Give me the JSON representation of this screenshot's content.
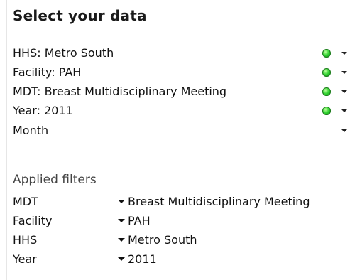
{
  "panel": {
    "title": "Select your data",
    "selectors": [
      {
        "label": "HHS:  Metro South",
        "status": "green"
      },
      {
        "label": "Facility:  PAH",
        "status": "green"
      },
      {
        "label": "MDT:  Breast Multidisciplinary Meeting",
        "status": "green"
      },
      {
        "label": "Year:  2011",
        "status": "green"
      },
      {
        "label": "Month",
        "status": "none"
      }
    ],
    "applied_title": "Applied filters",
    "applied_filters": [
      {
        "name": "MDT",
        "value": "Breast Multidisciplinary Meeting"
      },
      {
        "name": "Facility",
        "value": "PAH"
      },
      {
        "name": "HHS",
        "value": "Metro South"
      },
      {
        "name": "Year",
        "value": "2011"
      }
    ]
  },
  "colors": {
    "status_green": "#2fd12f",
    "text": "#111111",
    "muted": "#444444"
  },
  "icons": {
    "status": "green-dot-icon",
    "dropdown": "chevron-down-icon"
  }
}
